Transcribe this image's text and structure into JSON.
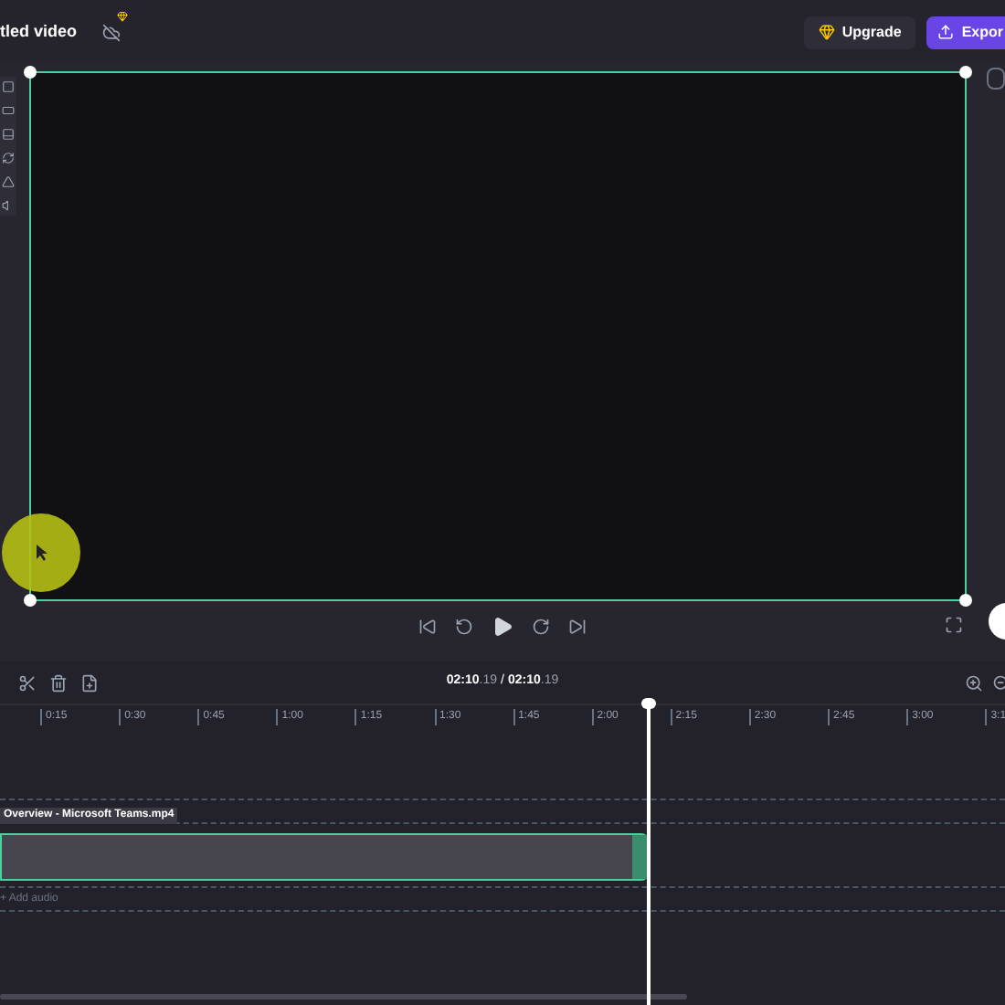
{
  "header": {
    "title": "tled video",
    "upgrade_button": "Upgrade",
    "export_button": "Expor"
  },
  "timeline": {
    "current_time": "**02:10**.19",
    "separator": "/",
    "total_time": "**02:10**.19",
    "ruler_labels": [
      "0:15",
      "0:30",
      "0:45",
      "1:00",
      "1:15",
      "1:30",
      "1:45",
      "2:00",
      "2:15",
      "2:30",
      "2:45",
      "3:00",
      "3:1"
    ],
    "clip": {
      "name": "Overview - Microsoft Teams.mp4",
      "selected": true
    },
    "add_audio": "+ Add audio"
  }
}
